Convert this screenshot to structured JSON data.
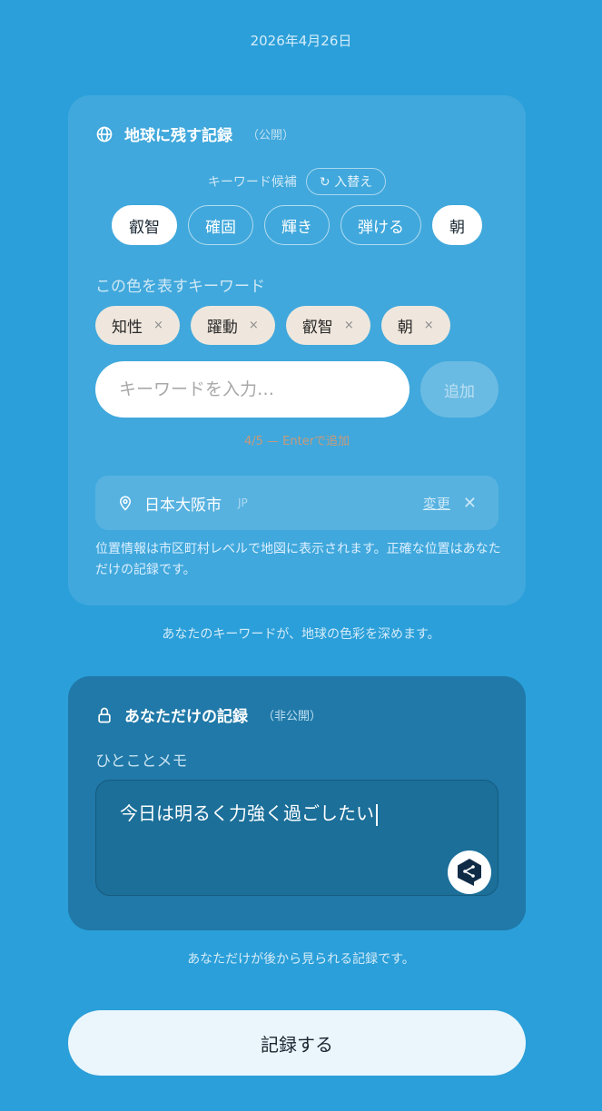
{
  "date": "2026年4月26日",
  "public_card": {
    "title": "地球に残す記録",
    "tag": "（公開）",
    "candidate_label": "キーワード候補",
    "refresh_label": "↻ 入替え",
    "candidates": [
      {
        "label": "叡智",
        "selected": true
      },
      {
        "label": "確固",
        "selected": false
      },
      {
        "label": "輝き",
        "selected": false
      },
      {
        "label": "弾ける",
        "selected": false
      },
      {
        "label": "朝",
        "selected": true
      }
    ],
    "keyword_label": "この色を表すキーワード",
    "keywords": [
      {
        "label": "知性",
        "remove": "×"
      },
      {
        "label": "躍動",
        "remove": "×"
      },
      {
        "label": "叡智",
        "remove": "×"
      },
      {
        "label": "朝",
        "remove": "×"
      }
    ],
    "input_placeholder": "キーワードを入力…",
    "add_label": "追加",
    "hint": "4/5 — Enterで追加",
    "location": {
      "city": "日本大阪市",
      "country": "JP",
      "change_label": "変更",
      "close": "✕"
    },
    "location_note": "位置情報は市区町村レベルで地図に表示されます。正確な位置はあなただけの記録です。"
  },
  "public_caption": "あなたのキーワードが、地球の色彩を深めます。",
  "private_card": {
    "title": "あなただけの記録",
    "tag": "（非公開）",
    "memo_label": "ひとことメモ",
    "memo_value": "今日は明るく力強く過ごしたい"
  },
  "private_caption": "あなただけが後から見られる記録です。",
  "submit_label": "記録する",
  "colors": {
    "background": "#2b9fd9",
    "private_card": "#2079a8",
    "keyword_tag": "#efe7dd"
  },
  "icons": {
    "globe": "globe-icon",
    "location": "map-pin-icon",
    "lock": "lock-icon",
    "deepl": "deepl-icon"
  }
}
